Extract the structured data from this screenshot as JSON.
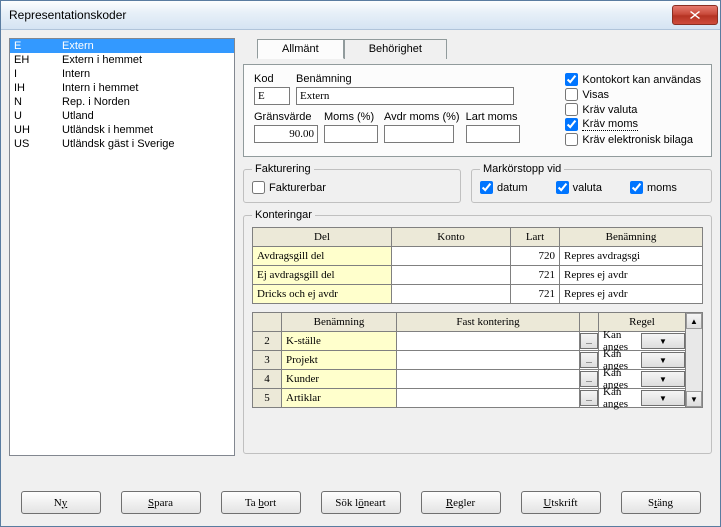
{
  "title": "Representationskoder",
  "list": [
    {
      "code": "E",
      "name": "Extern",
      "selected": true
    },
    {
      "code": "EH",
      "name": "Extern i hemmet"
    },
    {
      "code": "I",
      "name": "Intern"
    },
    {
      "code": "IH",
      "name": "Intern i hemmet"
    },
    {
      "code": "N",
      "name": "Rep. i Norden"
    },
    {
      "code": "U",
      "name": "Utland"
    },
    {
      "code": "UH",
      "name": "Utländsk i hemmet"
    },
    {
      "code": "US",
      "name": "Utländsk gäst i Sverige"
    }
  ],
  "tabs": {
    "general": "Allmänt",
    "auth": "Behörighet"
  },
  "fields": {
    "kod_label": "Kod",
    "kod_value": "E",
    "benamning_label": "Benämning",
    "benamning_value": "Extern",
    "gransvarde_label": "Gränsvärde",
    "gransvarde_value": "90.00",
    "moms_label": "Moms (%)",
    "moms_value": "",
    "avdrmoms_label": "Avdr moms (%)",
    "avdrmoms_value": "",
    "lartmoms_label": "Lart moms",
    "lartmoms_value": ""
  },
  "checks": {
    "kontokort": {
      "label": "Kontokort kan användas",
      "checked": true
    },
    "visas": {
      "label": "Visas",
      "checked": false
    },
    "kravvaluta": {
      "label": "Kräv valuta",
      "checked": false
    },
    "kravmoms": {
      "label": "Kräv moms",
      "checked": true,
      "focused": true
    },
    "kravbilaga": {
      "label": "Kräv elektronisk bilaga",
      "checked": false
    }
  },
  "fakturering": {
    "legend": "Fakturering",
    "fakturerbar_label": "Fakturerbar",
    "fakturerbar_checked": false
  },
  "markorstopp": {
    "legend": "Markörstopp vid",
    "datum_label": "datum",
    "datum_checked": true,
    "valuta_label": "valuta",
    "valuta_checked": true,
    "moms_label": "moms",
    "moms_checked": true
  },
  "konteringar": {
    "legend": "Konteringar",
    "headers": {
      "del": "Del",
      "konto": "Konto",
      "lart": "Lart",
      "benamning": "Benämning"
    },
    "rows": [
      {
        "del": "Avdragsgill del",
        "konto": "",
        "lart": "720",
        "ben": "Repres avdragsgi"
      },
      {
        "del": "Ej avdragsgill del",
        "konto": "",
        "lart": "721",
        "ben": "Repres ej avdr"
      },
      {
        "del": "Dricks och ej avdr",
        "konto": "",
        "lart": "721",
        "ben": "Repres ej avdr"
      }
    ],
    "headers2": {
      "benamning": "Benämning",
      "fast": "Fast kontering",
      "regel": "Regel"
    },
    "rows2": [
      {
        "n": "2",
        "ben": "K-ställe",
        "fast": "",
        "regel": "Kan anges"
      },
      {
        "n": "3",
        "ben": "Projekt",
        "fast": "",
        "regel": "Kan anges"
      },
      {
        "n": "4",
        "ben": "Kunder",
        "fast": "",
        "regel": "Kan anges"
      },
      {
        "n": "5",
        "ben": "Artiklar",
        "fast": "",
        "regel": "Kan anges"
      }
    ],
    "ellipsis": "...",
    "arrow": "▼"
  },
  "buttons": {
    "ny": "Ny",
    "spara": "Spara",
    "tabort": "Ta bort",
    "sokloneart": "Sök löneart",
    "regler": "Regler",
    "utskrift": "Utskrift",
    "stang": "Stäng"
  }
}
